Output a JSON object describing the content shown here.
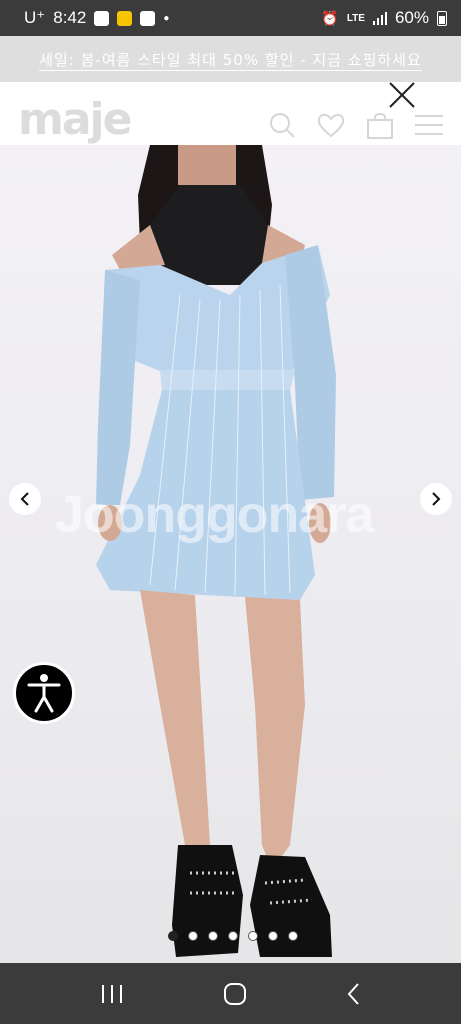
{
  "status_bar": {
    "carrier": "U⁺",
    "time": "8:42",
    "network": "LTE",
    "battery": "60%"
  },
  "promo": {
    "text": "세일: 봄-여름 스타일 최대 50% 할인 - 지금 쇼핑하세요"
  },
  "header": {
    "logo": "maje"
  },
  "product": {
    "watermark": "Joonggonara",
    "image_count": 7,
    "active_index": 0
  },
  "icons": {
    "search": "search-icon",
    "wishlist": "heart-icon",
    "bag": "shopping-bag-icon",
    "menu": "hamburger-menu-icon",
    "close": "close-icon",
    "prev": "chevron-left-icon",
    "next": "chevron-right-icon",
    "accessibility": "accessibility-icon"
  },
  "colors": {
    "banner_bg": "#dedede",
    "status_bar_bg": "#3b3b3b",
    "dress": "#b9d4ec"
  }
}
